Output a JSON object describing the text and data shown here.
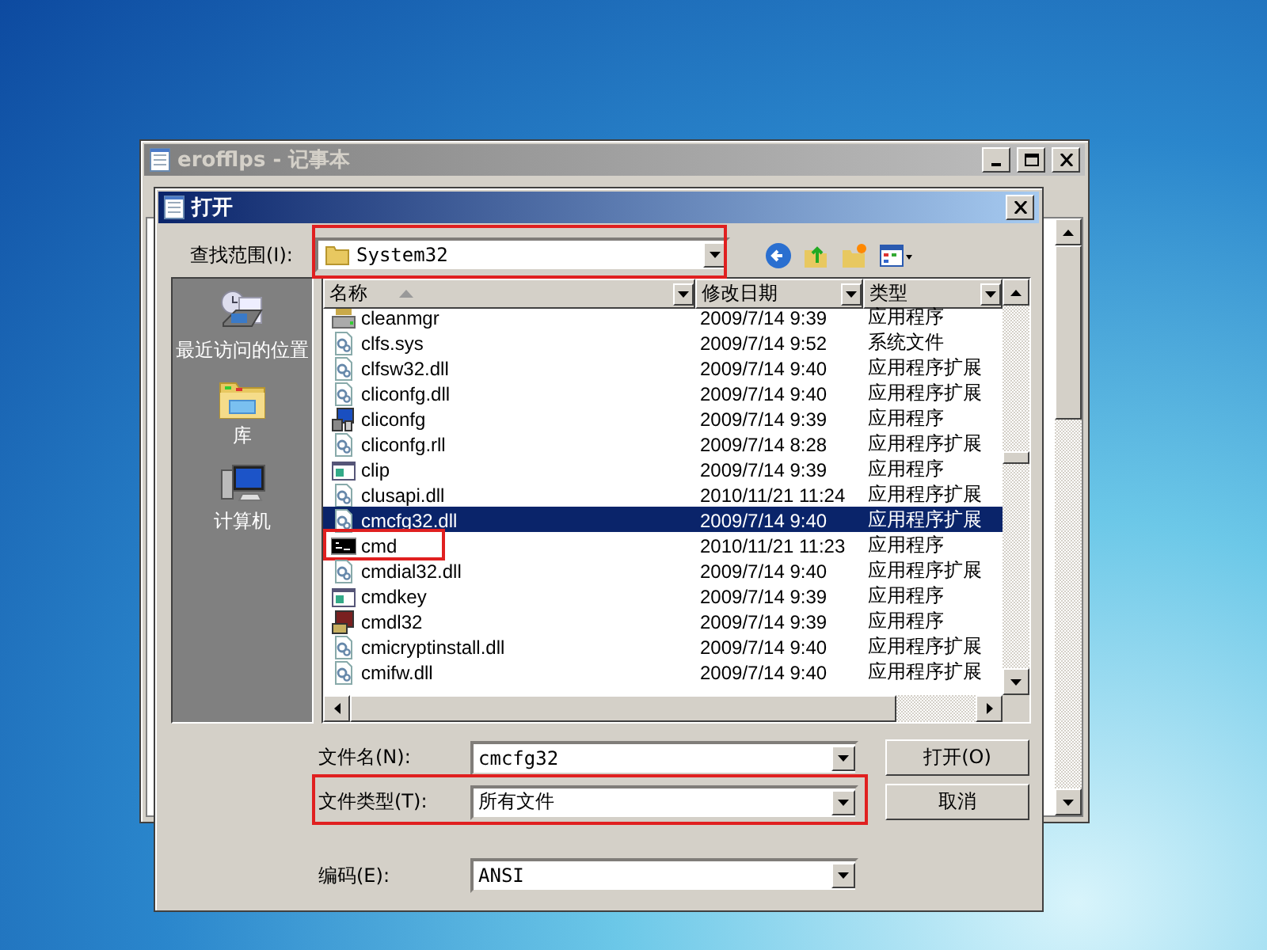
{
  "notepad": {
    "title": "erofflps - 记事本",
    "active": false
  },
  "dialog": {
    "title": "打开",
    "active": true
  },
  "look_in": {
    "label": "查找范围(I):",
    "value": "System32",
    "highlighted": true
  },
  "places": [
    {
      "label": "最近访问的位置",
      "kind": "recent"
    },
    {
      "label": "库",
      "kind": "library"
    },
    {
      "label": "计算机",
      "kind": "computer"
    }
  ],
  "columns": [
    {
      "label": "名称",
      "sorted": true
    },
    {
      "label": "修改日期",
      "sorted": false
    },
    {
      "label": "类型",
      "sorted": false
    }
  ],
  "rows": [
    {
      "name": "cleanmgr",
      "date": "2009/7/14 9:39",
      "type": "应用程序",
      "kind": "drive",
      "selected": false,
      "highlighted": false
    },
    {
      "name": "clfs.sys",
      "date": "2009/7/14 9:52",
      "type": "系统文件",
      "kind": "gear",
      "selected": false,
      "highlighted": false
    },
    {
      "name": "clfsw32.dll",
      "date": "2009/7/14 9:40",
      "type": "应用程序扩展",
      "kind": "gear",
      "selected": false,
      "highlighted": false
    },
    {
      "name": "cliconfg.dll",
      "date": "2009/7/14 9:40",
      "type": "应用程序扩展",
      "kind": "gear",
      "selected": false,
      "highlighted": false
    },
    {
      "name": "cliconfg",
      "date": "2009/7/14 9:39",
      "type": "应用程序",
      "kind": "tool",
      "selected": false,
      "highlighted": false
    },
    {
      "name": "cliconfg.rll",
      "date": "2009/7/14 8:28",
      "type": "应用程序扩展",
      "kind": "gear",
      "selected": false,
      "highlighted": false
    },
    {
      "name": "clip",
      "date": "2009/7/14 9:39",
      "type": "应用程序",
      "kind": "window",
      "selected": false,
      "highlighted": false
    },
    {
      "name": "clusapi.dll",
      "date": "2010/11/21 11:24",
      "type": "应用程序扩展",
      "kind": "gear",
      "selected": false,
      "highlighted": false
    },
    {
      "name": "cmcfg32.dll",
      "date": "2009/7/14 9:40",
      "type": "应用程序扩展",
      "kind": "gear",
      "selected": true,
      "highlighted": false
    },
    {
      "name": "cmd",
      "date": "2010/11/21 11:23",
      "type": "应用程序",
      "kind": "console",
      "selected": false,
      "highlighted": true
    },
    {
      "name": "cmdial32.dll",
      "date": "2009/7/14 9:40",
      "type": "应用程序扩展",
      "kind": "gear",
      "selected": false,
      "highlighted": false
    },
    {
      "name": "cmdkey",
      "date": "2009/7/14 9:39",
      "type": "应用程序",
      "kind": "window",
      "selected": false,
      "highlighted": false
    },
    {
      "name": "cmdl32",
      "date": "2009/7/14 9:39",
      "type": "应用程序",
      "kind": "box",
      "selected": false,
      "highlighted": false
    },
    {
      "name": "cmicryptinstall.dll",
      "date": "2009/7/14 9:40",
      "type": "应用程序扩展",
      "kind": "gear",
      "selected": false,
      "highlighted": false
    },
    {
      "name": "cmifw.dll",
      "date": "2009/7/14 9:40",
      "type": "应用程序扩展",
      "kind": "gear",
      "selected": false,
      "highlighted": false
    }
  ],
  "fields": [
    {
      "label": "文件名(N):",
      "value": "cmcfg32",
      "highlighted": false
    },
    {
      "label": "文件类型(T):",
      "value": "所有文件",
      "highlighted": true
    },
    {
      "label": "编码(E):",
      "value": "ANSI",
      "highlighted": false
    }
  ],
  "buttons": [
    "打开(O)",
    "取消"
  ]
}
